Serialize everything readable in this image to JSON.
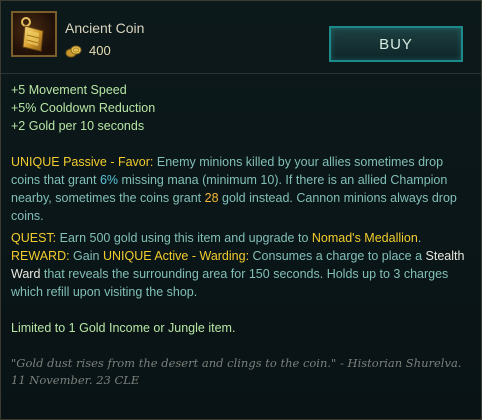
{
  "item": {
    "name": "Ancient Coin",
    "price": "400",
    "icon": "ancient-coin-icon"
  },
  "buy_label": "BUY",
  "stats": [
    "+5 Movement Speed",
    "+5% Cooldown Reduction",
    "+2 Gold per 10 seconds"
  ],
  "passive": {
    "label": "UNIQUE Passive - Favor:",
    "text_1": " Enemy minions killed by your allies sometimes drop coins that grant ",
    "value_mana": "6%",
    "text_2": " missing mana (minimum 10). If there is an allied Champion nearby, sometimes the coins grant ",
    "value_gold": "28",
    "text_3": " gold instead. Cannon minions always drop coins."
  },
  "quest": {
    "label": "QUEST:",
    "text_1": " Earn 500 gold using this item and upgrade to ",
    "target_item": "Nomad's Medallion",
    "text_2": "."
  },
  "reward": {
    "label": "REWARD:",
    "text_1": " Gain ",
    "active_label": "UNIQUE Active - Warding:",
    "text_2": " Consumes a charge to place a ",
    "ward_name": "Stealth Ward",
    "text_3": " that reveals the surrounding area for 150 seconds. Holds up to 3 charges which refill upon visiting the shop."
  },
  "limit_text": "Limited to 1 Gold Income or Jungle item.",
  "flavor_text": "\"Gold dust rises from the desert and clings to the coin.\" - Historian Shurelva. 11 November. 23 CLE",
  "colors": {
    "unique_yellow": "#f2cc2e",
    "value_cyan": "#58c6d8",
    "stat_green": "#b7e6a4",
    "button_border": "#1c8a8a"
  }
}
